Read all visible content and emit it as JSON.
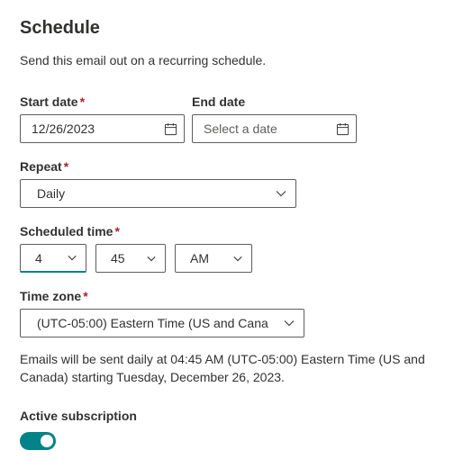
{
  "title": "Schedule",
  "description": "Send this email out on a recurring schedule.",
  "start_date": {
    "label": "Start date",
    "value": "12/26/2023",
    "required": true
  },
  "end_date": {
    "label": "End date",
    "placeholder": "Select a date",
    "required": false
  },
  "repeat": {
    "label": "Repeat",
    "value": "Daily",
    "required": true
  },
  "scheduled_time": {
    "label": "Scheduled time",
    "hour": "4",
    "minute": "45",
    "ampm": "AM",
    "required": true
  },
  "timezone": {
    "label": "Time zone",
    "value": "(UTC-05:00) Eastern Time (US and Cana",
    "required": true
  },
  "summary": "Emails will be sent daily at 04:45 AM (UTC-05:00) Eastern Time (US and Canada) starting Tuesday, December 26, 2023.",
  "active": {
    "label": "Active subscription",
    "on": true
  }
}
